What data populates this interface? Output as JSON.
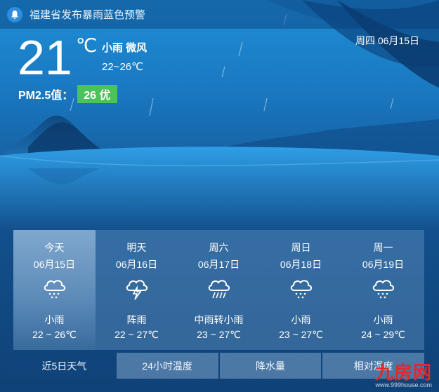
{
  "alert": {
    "text": "福建省发布暴雨蓝色预警",
    "icon": "bell-icon"
  },
  "current": {
    "temperature": "21",
    "unit": "℃",
    "condition": "小雨 微风",
    "range": "22~26℃",
    "date": "周四 06月15日",
    "pm_label": "PM2.5值：",
    "pm_value": "26 优"
  },
  "forecast": [
    {
      "day": "今天",
      "date": "06月15日",
      "cond": "小雨",
      "range": "22 ~ 26℃",
      "icon": "light-rain-icon"
    },
    {
      "day": "明天",
      "date": "06月16日",
      "cond": "阵雨",
      "range": "22 ~ 27℃",
      "icon": "thunder-shower-icon"
    },
    {
      "day": "周六",
      "date": "06月17日",
      "cond": "中雨转小雨",
      "range": "23 ~ 27℃",
      "icon": "moderate-rain-icon"
    },
    {
      "day": "周日",
      "date": "06月18日",
      "cond": "小雨",
      "range": "23 ~ 27℃",
      "icon": "light-rain-icon"
    },
    {
      "day": "周一",
      "date": "06月19日",
      "cond": "小雨",
      "range": "24 ~ 29℃",
      "icon": "light-rain-icon"
    }
  ],
  "tabs": [
    "近5日天气",
    "24小时温度",
    "降水量",
    "相对湿度"
  ],
  "watermark": {
    "main": "九房网",
    "sub": "www.999house.com"
  },
  "colors": {
    "pm_good": "#4bc35a",
    "watermark": "#e02a2a"
  }
}
